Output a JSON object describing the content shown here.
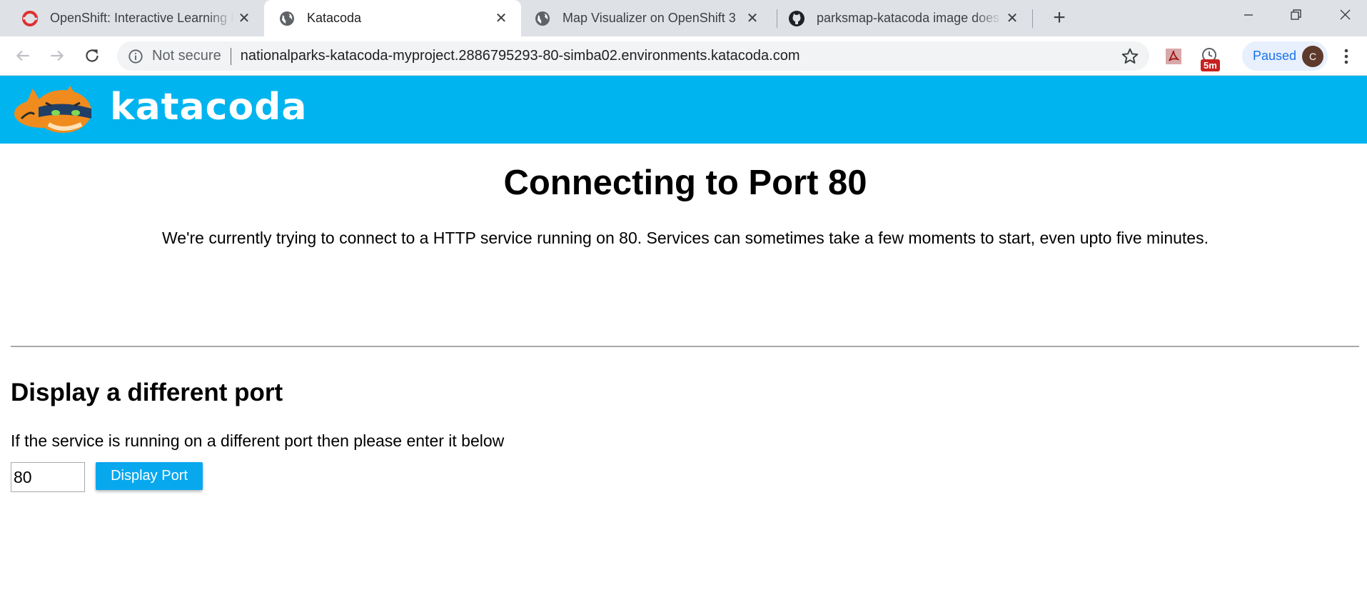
{
  "tabs": [
    {
      "title": "OpenShift: Interactive Learning Portal",
      "icon": "openshift-icon",
      "active": false
    },
    {
      "title": "Katacoda",
      "icon": "globe-icon",
      "active": true
    },
    {
      "title": "Map Visualizer on OpenShift 3",
      "icon": "globe-icon",
      "active": false
    },
    {
      "title": "parksmap-katacoda image does not",
      "icon": "github-icon",
      "active": false
    }
  ],
  "tab_close_glyph": "✕",
  "new_tab_glyph": "+",
  "window_controls": {
    "minimize": "─",
    "restore": "❐",
    "close": "✕"
  },
  "omnibox": {
    "security": "Not secure",
    "url": "nationalparks-katacoda-myproject.2886795293-80-simba02.environments.katacoda.com"
  },
  "extensions": {
    "timer_badge": "5m"
  },
  "profile": {
    "label": "Paused",
    "avatar_letter": "C"
  },
  "header": {
    "brand": "katacoda",
    "color": "#00b4ef"
  },
  "main": {
    "title": "Connecting to Port 80",
    "description": "We're currently trying to connect to a HTTP service running on 80. Services can sometimes take a few moments to start, even upto five minutes."
  },
  "port_section": {
    "title": "Display a different port",
    "description": "If the service is running on a different port then please enter it below",
    "port_value": "80",
    "button_label": "Display Port"
  }
}
